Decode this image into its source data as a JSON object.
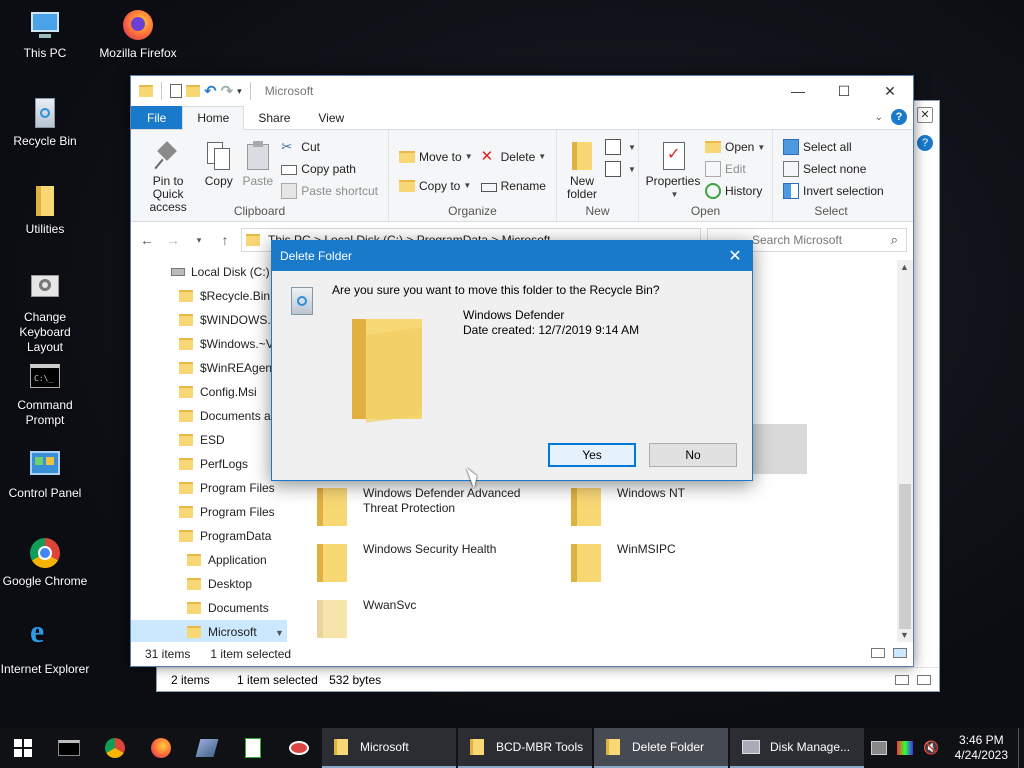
{
  "desktop": {
    "icons": [
      {
        "label": "This PC"
      },
      {
        "label": "Mozilla Firefox"
      },
      {
        "label": "Recycle Bin"
      },
      {
        "label": "Utilities"
      },
      {
        "label": "Change Keyboard Layout"
      },
      {
        "label": "Command Prompt"
      },
      {
        "label": "Control Panel"
      },
      {
        "label": "Google Chrome"
      },
      {
        "label": "Internet Explorer"
      }
    ]
  },
  "back_window": {
    "status_items": "2 items",
    "status_selected": "1 item selected",
    "status_size": "532 bytes"
  },
  "explorer": {
    "title": "Microsoft",
    "tabs": {
      "file": "File",
      "home": "Home",
      "share": "Share",
      "view": "View"
    },
    "clipboard": {
      "group": "Clipboard",
      "pin": "Pin to Quick access",
      "copy": "Copy",
      "paste": "Paste",
      "cut": "Cut",
      "copy_path": "Copy path",
      "paste_shortcut": "Paste shortcut"
    },
    "organize": {
      "group": "Organize",
      "move_to": "Move to",
      "copy_to": "Copy to",
      "delete": "Delete",
      "rename": "Rename"
    },
    "new": {
      "group": "New",
      "new_folder": "New folder"
    },
    "open": {
      "group": "Open",
      "properties": "Properties",
      "open": "Open",
      "edit": "Edit",
      "history": "History"
    },
    "select": {
      "group": "Select",
      "select_all": "Select all",
      "select_none": "Select none",
      "invert": "Invert selection"
    },
    "address": "This PC  >  Local Disk (C:)  >  ProgramData  >  Microsoft",
    "search_placeholder": "Search Microsoft",
    "nav": {
      "drive": "Local Disk (C:)",
      "items": [
        "$Recycle.Bin",
        "$WINDOWS.~",
        "$Windows.~V",
        "$WinREAgent",
        "Config.Msi",
        "Documents a",
        "ESD",
        "PerfLogs",
        "Program Files",
        "Program Files",
        "ProgramData"
      ],
      "sub_items": [
        "Application",
        "Desktop",
        "Documents",
        "Microsoft"
      ]
    },
    "content_items": [
      "Windows Defender Advanced Threat Protection",
      "Windows NT",
      "Windows Security Health",
      "WinMSIPC",
      "WwanSvc"
    ],
    "status_items": "31 items",
    "status_selected": "1 item selected"
  },
  "dialog": {
    "title": "Delete Folder",
    "question": "Are you sure you want to move this folder to the Recycle Bin?",
    "item_name": "Windows Defender",
    "item_date": "Date created: 12/7/2019 9:14 AM",
    "yes": "Yes",
    "no": "No"
  },
  "taskbar": {
    "windows": [
      "Microsoft",
      "BCD-MBR Tools",
      "Delete Folder",
      "Disk Manage..."
    ],
    "time": "3:46 PM",
    "date": "4/24/2023"
  }
}
